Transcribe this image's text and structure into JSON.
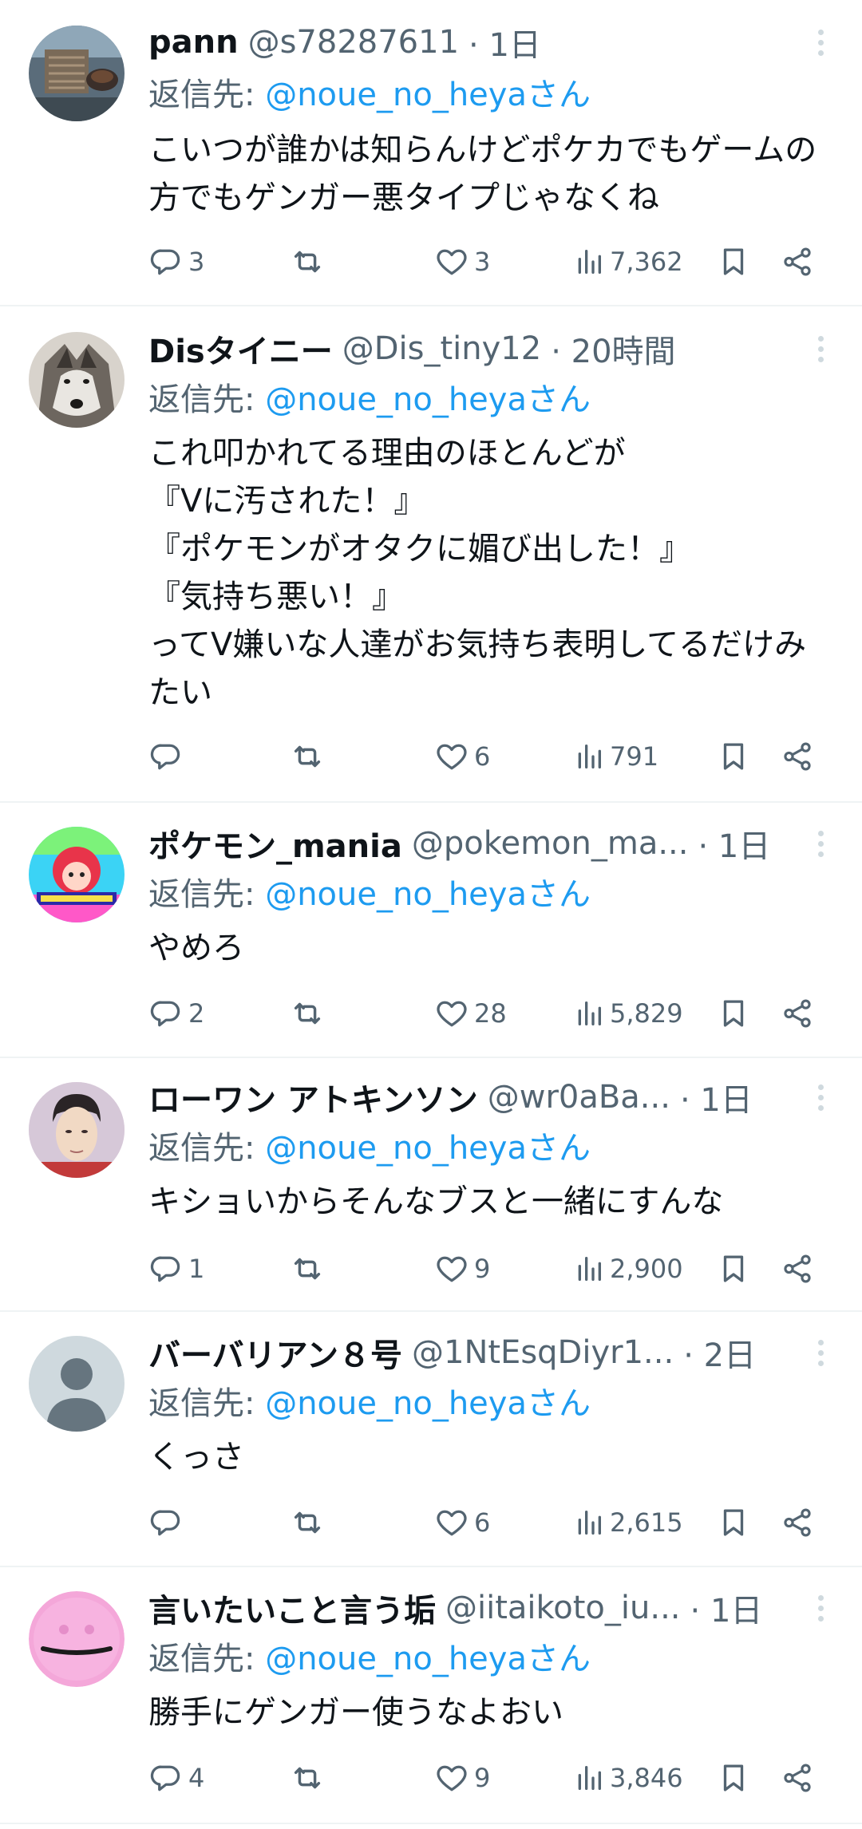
{
  "reply_prefix": "返信先: ",
  "tweets": [
    {
      "display_name": "pann",
      "handle": "@s78287611",
      "time": "· 1日",
      "reply_handle": "@noue_no_heyaさん",
      "text": "こいつが誰かは知らんけどポケカでもゲームの方でもゲンガー悪タイプじゃなくね",
      "replies": "3",
      "retweets": "",
      "likes": "3",
      "views": "7,362",
      "avatar_icon": "food-photo-avatar"
    },
    {
      "display_name": "Disタイニー",
      "handle": "@Dis_tiny12",
      "time": "· 20時間",
      "reply_handle": "@noue_no_heyaさん",
      "text": "これ叩かれてる理由のほとんどが\n『Vに汚された！』\n『ポケモンがオタクに媚び出した！』\n『気持ち悪い！』\nってV嫌いな人達がお気持ち表明してるだけみたい",
      "replies": "",
      "retweets": "",
      "likes": "6",
      "views": "791",
      "avatar_icon": "wolf-avatar"
    },
    {
      "display_name": "ポケモン_mania",
      "handle": "@pokemon_ma...",
      "time": "· 1日",
      "reply_handle": "@noue_no_heyaさん",
      "text": "やめろ",
      "replies": "2",
      "retweets": "",
      "likes": "28",
      "views": "5,829",
      "avatar_icon": "colorful-anime-avatar"
    },
    {
      "display_name": "ローワン アトキンソン",
      "handle": "@wr0aBa...",
      "time": "· 1日",
      "reply_handle": "@noue_no_heyaさん",
      "text": "キショいからそんなブスと一緒にすんな",
      "replies": "1",
      "retweets": "",
      "likes": "9",
      "views": "2,900",
      "avatar_icon": "portrait-avatar"
    },
    {
      "display_name": "バーバリアン８号",
      "handle": "@1NtEsqDiyr1...",
      "time": "· 2日",
      "reply_handle": "@noue_no_heyaさん",
      "text": "くっさ",
      "replies": "",
      "retweets": "",
      "likes": "6",
      "views": "2,615",
      "avatar_icon": "default-user-avatar"
    },
    {
      "display_name": "言いたいこと言う垢",
      "handle": "@iitaikoto_iu...",
      "time": "· 1日",
      "reply_handle": "@noue_no_heyaさん",
      "text": "勝手にゲンガー使うなよおい",
      "replies": "4",
      "retweets": "",
      "likes": "9",
      "views": "3,846",
      "avatar_icon": "pink-face-avatar"
    }
  ]
}
